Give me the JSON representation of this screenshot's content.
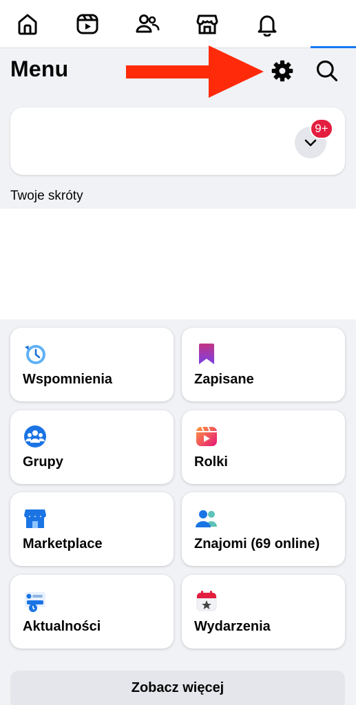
{
  "topnav": {
    "items": [
      {
        "icon": "home-icon"
      },
      {
        "icon": "video-icon"
      },
      {
        "icon": "friends-icon"
      },
      {
        "icon": "marketplace-icon"
      },
      {
        "icon": "bell-icon"
      },
      {
        "icon": "menu-tab",
        "active": true
      }
    ],
    "accent": "#1877f2"
  },
  "header": {
    "title": "Menu",
    "settings_icon": "gear-icon",
    "search_icon": "search-icon",
    "annotation_color": "#ff2a0a"
  },
  "profile_card": {
    "badge": "9+",
    "badge_color": "#e41e3f"
  },
  "shortcuts": {
    "label": "Twoje skróty"
  },
  "tiles": [
    {
      "label": "Wspomnienia",
      "icon": "memories-clock-icon"
    },
    {
      "label": "Zapisane",
      "icon": "saved-bookmark-icon"
    },
    {
      "label": "Grupy",
      "icon": "groups-icon"
    },
    {
      "label": "Rolki",
      "icon": "reels-icon"
    },
    {
      "label": "Marketplace",
      "icon": "marketplace-shop-icon"
    },
    {
      "label": "Znajomi (69 online)",
      "icon": "friends-people-icon"
    },
    {
      "label": "Aktualności",
      "icon": "feeds-icon"
    },
    {
      "label": "Wydarzenia",
      "icon": "events-calendar-icon"
    }
  ],
  "see_more": {
    "label": "Zobacz więcej"
  }
}
